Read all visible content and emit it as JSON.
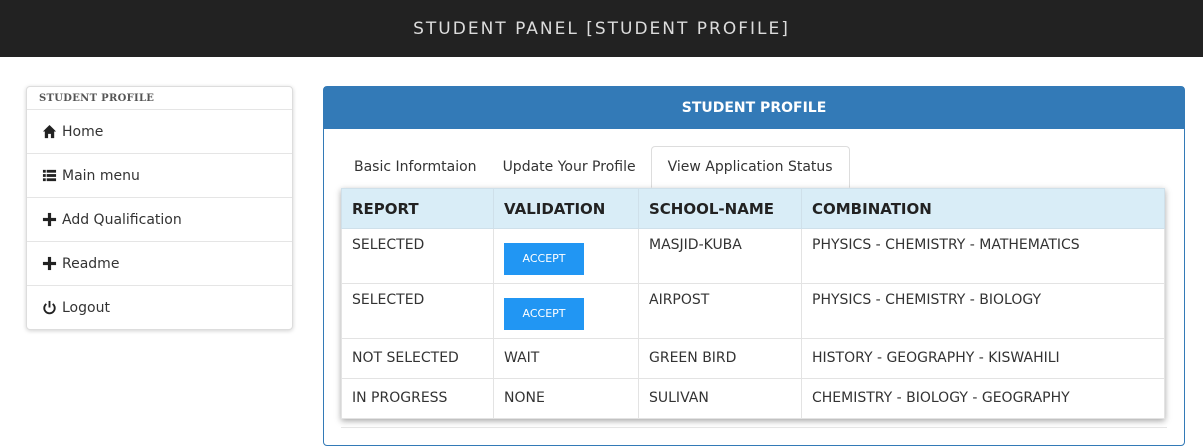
{
  "header": {
    "title": "STUDENT PANEL [STUDENT PROFILE]"
  },
  "sidebar": {
    "heading": "STUDENT PROFILE",
    "items": [
      {
        "label": "Home",
        "icon": "home-icon"
      },
      {
        "label": "Main menu",
        "icon": "list-icon"
      },
      {
        "label": "Add Qualification",
        "icon": "plus-icon"
      },
      {
        "label": "Readme",
        "icon": "plus-icon"
      },
      {
        "label": "Logout",
        "icon": "power-icon"
      }
    ]
  },
  "panel": {
    "title": "STUDENT PROFILE",
    "tabs": [
      {
        "label": "Basic Informtaion"
      },
      {
        "label": "Update Your Profile"
      },
      {
        "label": "View Application Status"
      }
    ],
    "active_tab": "View Application Status",
    "table": {
      "headers": [
        "REPORT",
        "VALIDATION",
        "SCHOOL-NAME",
        "COMBINATION"
      ],
      "rows": [
        {
          "report": "SELECTED",
          "validation": "ACCEPT",
          "school": "MASJID-KUBA",
          "combination": "PHYSICS - CHEMISTRY - MATHEMATICS"
        },
        {
          "report": "SELECTED",
          "validation": "ACCEPT",
          "school": "AIRPOST",
          "combination": "PHYSICS - CHEMISTRY - BIOLOGY"
        },
        {
          "report": "NOT SELECTED",
          "validation": "WAIT",
          "school": "GREEN BIRD",
          "combination": "HISTORY - GEOGRAPHY - KISWAHILI"
        },
        {
          "report": "IN PROGRESS",
          "validation": "NONE",
          "school": "SULIVAN",
          "combination": "CHEMISTRY - BIOLOGY - GEOGRAPHY"
        }
      ]
    }
  },
  "colors": {
    "topbar": "#222222",
    "primary": "#337ab7",
    "table_header": "#d9edf7",
    "accept_button": "#2196f3"
  }
}
